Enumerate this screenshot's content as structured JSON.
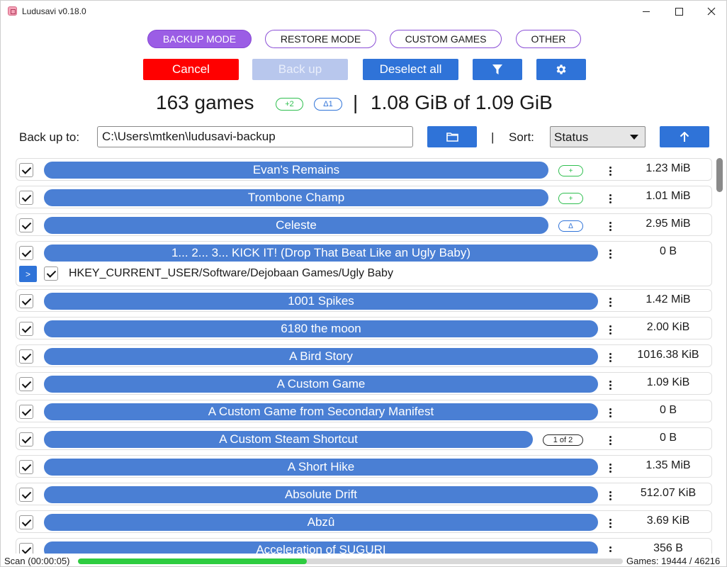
{
  "window": {
    "title": "Ludusavi v0.18.0"
  },
  "modes": [
    {
      "label": "BACKUP MODE",
      "active": true
    },
    {
      "label": "RESTORE MODE",
      "active": false
    },
    {
      "label": "CUSTOM GAMES",
      "active": false
    },
    {
      "label": "OTHER",
      "active": false
    }
  ],
  "toolbar": {
    "cancel_label": "Cancel",
    "backup_label": "Back up",
    "deselect_label": "Deselect all",
    "filter_icon": "filter-icon",
    "settings_icon": "gear-icon"
  },
  "summary": {
    "count": "163 games",
    "new_badge": "+2",
    "changed_badge": "Δ1",
    "separator": "|",
    "size": "1.08 GiB of 1.09 GiB"
  },
  "target": {
    "label": "Back up to:",
    "path": "C:\\Users\\mtken\\ludusavi-backup",
    "folder_icon": "folder-icon",
    "separator": "|",
    "sort_label": "Sort:",
    "sort_value": "Status",
    "sort_dir_icon": "arrow-up-icon"
  },
  "games": [
    {
      "name": "Evan's Remains",
      "size": "1.23 MiB",
      "badge": "+"
    },
    {
      "name": "Trombone Champ",
      "size": "1.01 MiB",
      "badge": "+"
    },
    {
      "name": "Celeste",
      "size": "2.95 MiB",
      "badge": "Δ"
    },
    {
      "name": "1... 2... 3... KICK IT! (Drop That Beat Like an Ugly Baby)",
      "size": "0 B",
      "badge": "",
      "expanded": true,
      "subpath": "HKEY_CURRENT_USER/Software/Dejobaan Games/Ugly Baby",
      "sub_expand": ">"
    },
    {
      "name": "1001 Spikes",
      "size": "1.42 MiB",
      "badge": ""
    },
    {
      "name": "6180 the moon",
      "size": "2.00 KiB",
      "badge": ""
    },
    {
      "name": "A Bird Story",
      "size": "1016.38 KiB",
      "badge": ""
    },
    {
      "name": "A Custom Game",
      "size": "1.09 KiB",
      "badge": ""
    },
    {
      "name": "A Custom Game from Secondary Manifest",
      "size": "0 B",
      "badge": ""
    },
    {
      "name": "A Custom Steam Shortcut",
      "size": "0 B",
      "badge": "1 of 2"
    },
    {
      "name": "A Short Hike",
      "size": "1.35 MiB",
      "badge": ""
    },
    {
      "name": "Absolute Drift",
      "size": "512.07 KiB",
      "badge": ""
    },
    {
      "name": "Abzû",
      "size": "3.69 KiB",
      "badge": ""
    },
    {
      "name": "Acceleration of SUGURI",
      "size": "356 B",
      "badge": ""
    }
  ],
  "status": {
    "left": "Scan  (00:00:05)",
    "progress": 0.42,
    "right": "Games: 19444 / 46216"
  }
}
